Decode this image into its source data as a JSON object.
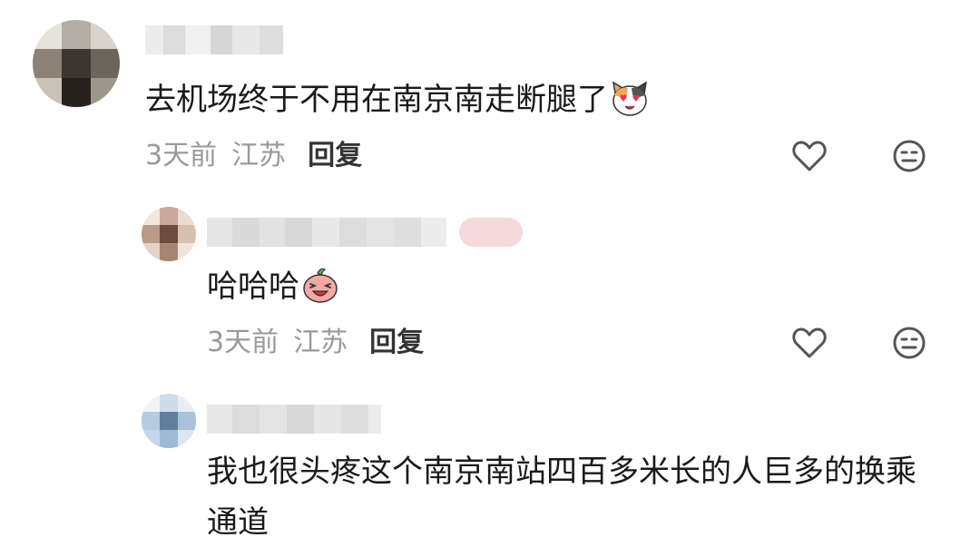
{
  "comments": [
    {
      "text": "去机场终于不用在南京南走断腿了",
      "emoji": "heart-eyes-cat-emoji",
      "time": "3天前",
      "location": "江苏",
      "reply_label": "回复"
    },
    {
      "text": "哈哈哈",
      "emoji": "laughing-peach-emoji",
      "time": "3天前",
      "location": "江苏",
      "reply_label": "回复"
    },
    {
      "text": "我也很头疼这个南京南站四百多米长的人巨多的换乘通道"
    }
  ],
  "colors": {
    "meta_gray": "#9a9a9a",
    "text": "#1a1a1a",
    "icon_gray": "#555555"
  }
}
